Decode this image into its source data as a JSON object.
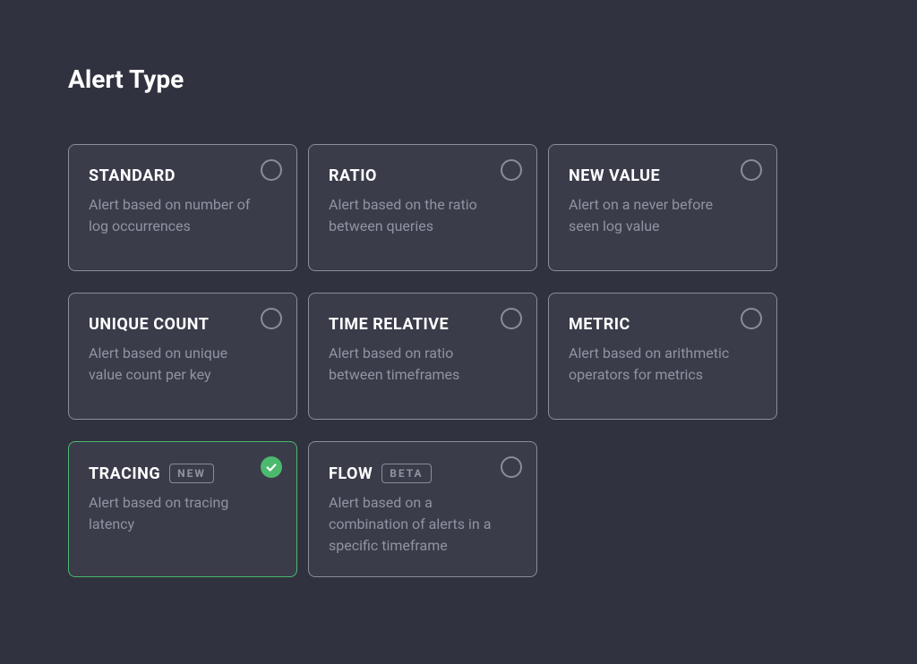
{
  "section": {
    "title": "Alert Type"
  },
  "cards": [
    {
      "id": "standard",
      "title": "STANDARD",
      "description": "Alert based on number of log occurrences",
      "badge": null,
      "selected": false
    },
    {
      "id": "ratio",
      "title": "RATIO",
      "description": "Alert based on the ratio between queries",
      "badge": null,
      "selected": false
    },
    {
      "id": "new-value",
      "title": "NEW VALUE",
      "description": "Alert on a never before seen log value",
      "badge": null,
      "selected": false
    },
    {
      "id": "unique-count",
      "title": "UNIQUE COUNT",
      "description": "Alert based on unique value count per key",
      "badge": null,
      "selected": false
    },
    {
      "id": "time-relative",
      "title": "TIME RELATIVE",
      "description": "Alert based on ratio between timeframes",
      "badge": null,
      "selected": false
    },
    {
      "id": "metric",
      "title": "METRIC",
      "description": "Alert based on arithmetic operators for metrics",
      "badge": null,
      "selected": false
    },
    {
      "id": "tracing",
      "title": "TRACING",
      "description": "Alert based on tracing latency",
      "badge": "NEW",
      "selected": true
    },
    {
      "id": "flow",
      "title": "FLOW",
      "description": "Alert based on a combination of alerts in a specific timeframe",
      "badge": "BETA",
      "selected": false
    }
  ]
}
